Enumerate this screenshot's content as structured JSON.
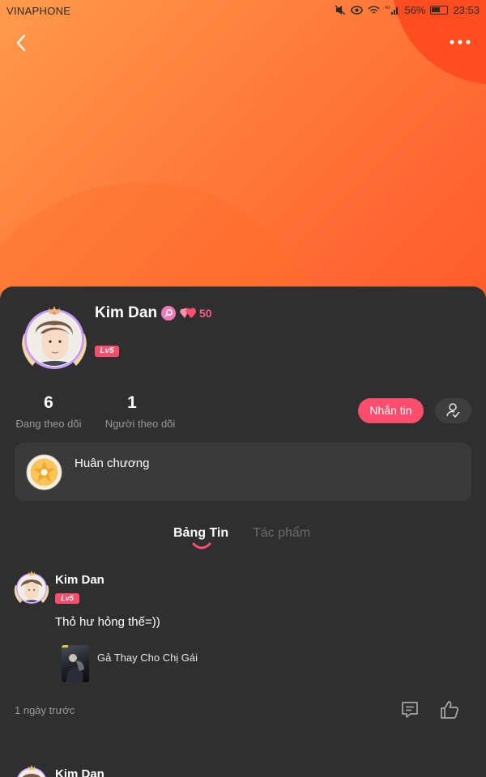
{
  "status_bar": {
    "carrier": "VINAPHONE",
    "network": "4G",
    "battery": "56%",
    "time": "23:53"
  },
  "profile": {
    "name": "Kim Dan",
    "level": "Lv5",
    "hearts": "50",
    "stats": [
      {
        "value": "6",
        "label": "Đang theo dõi"
      },
      {
        "value": "1",
        "label": "Người theo dõi"
      }
    ],
    "message_button": "Nhắn tin"
  },
  "medals": {
    "label": "Huân chương"
  },
  "tabs": [
    {
      "label": "Bảng Tin",
      "active": true
    },
    {
      "label": "Tác phẩm",
      "active": false
    }
  ],
  "posts": [
    {
      "author": "Kim Dan",
      "level": "Lv5",
      "text": "Thỏ hư hỏng thế=))",
      "book_title": "Gả Thay Cho Chị Gái",
      "time": "1 ngày trước"
    },
    {
      "author": "Kim Dan"
    }
  ],
  "colors": {
    "accent": "#ff4d6d",
    "hero_start": "#ff9a4a",
    "hero_end": "#ff5a2a",
    "background": "#2f2f2f"
  }
}
